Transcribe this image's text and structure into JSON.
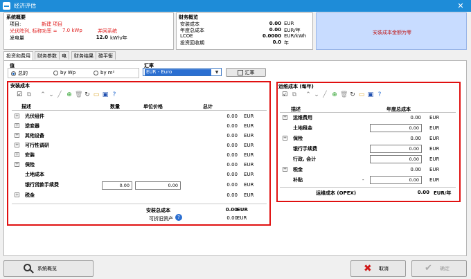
{
  "window": {
    "title": "经济评估",
    "close": "✕"
  },
  "summary_left": {
    "heading": "系统概要",
    "project_label": "项目:",
    "project_value": "新建 项目",
    "pv_label": "光伏阵列, 标称功率 =",
    "pv_value": "7.0 kWp",
    "grid_system": "并网系统",
    "energy_label": "发电量",
    "energy_value": "12.0",
    "energy_unit": "kWh/年"
  },
  "summary_mid": {
    "heading": "财务概览",
    "rows": [
      {
        "label": "安装成本",
        "value": "0.00",
        "unit": "EUR"
      },
      {
        "label": "年度总成本",
        "value": "0.00",
        "unit": "EUR/年"
      },
      {
        "label": "LCOE",
        "value": "0.0000",
        "unit": "EUR/kWh"
      },
      {
        "label": "投资回收期",
        "value": "0.0",
        "unit": "年"
      }
    ]
  },
  "warning": {
    "text": "安装成本金额为零"
  },
  "tabs": [
    {
      "label": "投资和费用",
      "active": true
    },
    {
      "label": "财务参数",
      "active": false
    },
    {
      "label": "电",
      "active": false
    },
    {
      "label": "财务结果",
      "active": false
    },
    {
      "label": "碳平衡",
      "active": false
    }
  ],
  "values_group": {
    "heading": "值",
    "options": [
      {
        "label": "总的",
        "selected": true
      },
      {
        "label": "by Wp",
        "selected": false
      },
      {
        "label": "by m²",
        "selected": false
      }
    ]
  },
  "currency": {
    "heading": "汇率",
    "selected": "EUR - Euro",
    "rate_button": "汇率"
  },
  "install": {
    "heading": "安装成本",
    "col_desc": "描述",
    "col_qty": "数量",
    "col_price": "单位价格",
    "col_total": "总计",
    "rows": [
      {
        "label": "光伏组件",
        "expand": true,
        "value": "0.00",
        "unit": "EUR"
      },
      {
        "label": "逆变器",
        "expand": true,
        "value": "0.00",
        "unit": "EUR"
      },
      {
        "label": "其他设备",
        "expand": true,
        "value": "0.00",
        "unit": "EUR"
      },
      {
        "label": "可行性调研",
        "expand": true,
        "value": "0.00",
        "unit": "EUR"
      },
      {
        "label": "安装",
        "expand": true,
        "value": "0.00",
        "unit": "EUR"
      },
      {
        "label": "保险",
        "expand": true,
        "value": "0.00",
        "unit": "EUR"
      },
      {
        "label": "土地成本",
        "expand": false,
        "value": "0.00",
        "unit": "EUR"
      },
      {
        "label": "银行贷款手续费",
        "expand": false,
        "value": "0.00",
        "unit": "EUR",
        "qty": "0.00",
        "price": "0.00"
      },
      {
        "label": "税金",
        "expand": true,
        "value": "0.00",
        "unit": "EUR"
      }
    ],
    "total_label": "安装总成本",
    "total_value": "0.00",
    "total_unit": "EUR",
    "dep_label": "可折旧资产",
    "dep_value": "0.00",
    "dep_unit": "EUR"
  },
  "operating": {
    "heading": "运维成本 (每年)",
    "col_desc": "描述",
    "col_annual": "年度总成本",
    "rows": [
      {
        "label": "运维费用",
        "expand": true,
        "value": "0.00",
        "unit": "EUR",
        "input": false
      },
      {
        "label": "土地租金",
        "expand": false,
        "value": "0.00",
        "unit": "EUR",
        "input": true
      },
      {
        "label": "保险",
        "expand": true,
        "value": "0.00",
        "unit": "EUR",
        "input": false
      },
      {
        "label": "银行手续费",
        "expand": false,
        "value": "0.00",
        "unit": "EUR",
        "input": true
      },
      {
        "label": "行政, 会计",
        "expand": false,
        "value": "0.00",
        "unit": "EUR",
        "input": true
      },
      {
        "label": "税金",
        "expand": true,
        "value": "0.00",
        "unit": "EUR",
        "input": false
      },
      {
        "label": "补贴",
        "expand": false,
        "value": "0.00",
        "unit": "EUR",
        "input": true,
        "prefix": "-"
      }
    ],
    "total_label": "运维成本 (OPEX)",
    "total_value": "0.00",
    "total_unit": "EUR/年"
  },
  "footer": {
    "overview_button": "系统概览",
    "cancel_button": "取消",
    "ok_button": "确定"
  }
}
